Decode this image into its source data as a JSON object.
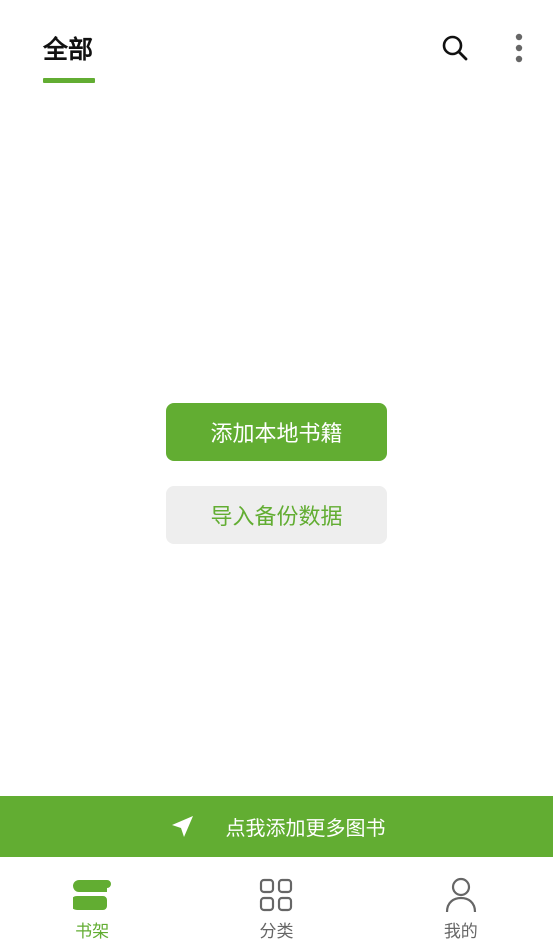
{
  "header": {
    "active_tab": "全部",
    "search_icon": "search-icon",
    "more_icon": "more-vertical-icon"
  },
  "main": {
    "add_local_books_label": "添加本地书籍",
    "import_backup_label": "导入备份数据"
  },
  "promo": {
    "icon": "navigation-arrow-icon",
    "text": "点我添加更多图书"
  },
  "bottom_nav": {
    "items": [
      {
        "label": "书架",
        "icon": "bookshelf-icon",
        "active": true
      },
      {
        "label": "分类",
        "icon": "grid-icon",
        "active": false
      },
      {
        "label": "我的",
        "icon": "person-icon",
        "active": false
      }
    ]
  },
  "colors": {
    "accent": "#62ad32",
    "button_secondary_bg": "#eeeeee",
    "text_primary": "#111111",
    "text_inactive": "#666666"
  }
}
